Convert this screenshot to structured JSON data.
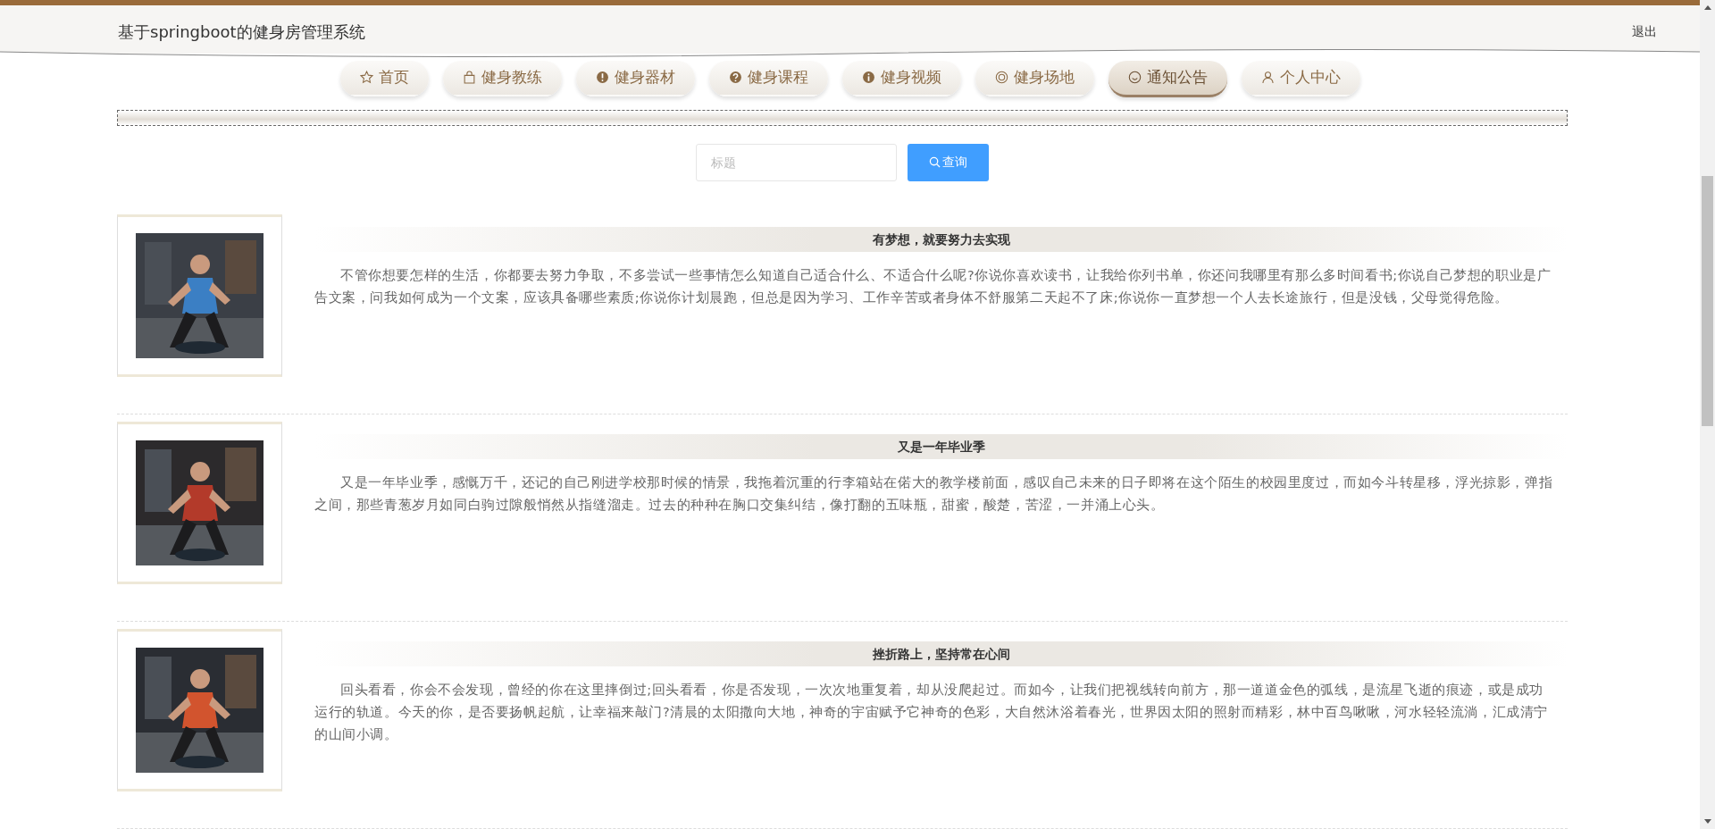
{
  "header": {
    "title": "基于springboot的健身房管理系统",
    "logout": "退出"
  },
  "nav": [
    {
      "label": "首页",
      "selected": false
    },
    {
      "label": "健身教练",
      "selected": false
    },
    {
      "label": "健身器材",
      "selected": false
    },
    {
      "label": "健身课程",
      "selected": false
    },
    {
      "label": "健身视频",
      "selected": false
    },
    {
      "label": "健身场地",
      "selected": false
    },
    {
      "label": "通知公告",
      "selected": true
    },
    {
      "label": "个人中心",
      "selected": false
    }
  ],
  "search": {
    "placeholder": "标题",
    "button": "查询"
  },
  "articles": [
    {
      "title": "有梦想，就要努力去实现",
      "text": "不管你想要怎样的生活，你都要去努力争取，不多尝试一些事情怎么知道自己适合什么、不适合什么呢?你说你喜欢读书，让我给你列书单，你还问我哪里有那么多时间看书;你说自己梦想的职业是广告文案，问我如何成为一个文案，应该具备哪些素质;你说你计划晨跑，但总是因为学习、工作辛苦或者身体不舒服第二天起不了床;你说你一直梦想一个人去长途旅行，但是没钱，父母觉得危险。"
    },
    {
      "title": "又是一年毕业季",
      "text": "又是一年毕业季，感慨万千，还记的自己刚进学校那时候的情景，我拖着沉重的行李箱站在偌大的教学楼前面，感叹自己未来的日子即将在这个陌生的校园里度过，而如今斗转星移，浮光掠影，弹指之间，那些青葱岁月如同白驹过隙般悄然从指缝溜走。过去的种种在胸口交集纠结，像打翻的五味瓶，甜蜜，酸楚，苦涩，一并涌上心头。"
    },
    {
      "title": "挫折路上，坚持常在心间",
      "text": "回头看看，你会不会发现，曾经的你在这里摔倒过;回头看看，你是否发现，一次次地重复着，却从没爬起过。而如今，让我们把视线转向前方，那一道道金色的弧线，是流星飞逝的痕迹，或是成功运行的轨道。今天的你，是否要扬帆起航，让幸福来敲门?清晨的太阳撒向大地，神奇的宇宙赋予它神奇的色彩，大自然沐浴着春光，世界因太阳的照射而精彩，林中百鸟啾啾，河水轻轻流淌，汇成清宁的山间小调。"
    }
  ]
}
